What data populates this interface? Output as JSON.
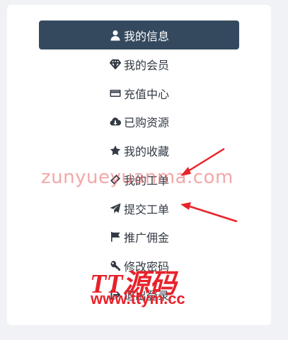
{
  "menu": {
    "items": [
      {
        "label": "我的信息",
        "icon": "user-icon",
        "active": true
      },
      {
        "label": "我的会员",
        "icon": "diamond-icon"
      },
      {
        "label": "充值中心",
        "icon": "credit-card-icon"
      },
      {
        "label": "已购资源",
        "icon": "cloud-download-icon"
      },
      {
        "label": "我的收藏",
        "icon": "star-icon"
      },
      {
        "label": "我的工单",
        "icon": "ticket-icon"
      },
      {
        "label": "提交工单",
        "icon": "paper-plane-icon"
      },
      {
        "label": "推广佣金",
        "icon": "flag-icon"
      },
      {
        "label": "修改密码",
        "icon": "key-icon"
      },
      {
        "label": "退出登录",
        "icon": "sign-out-icon"
      }
    ]
  },
  "overlays": {
    "watermark_text": "zunyueyuanma.com",
    "logo_text": "TT源码",
    "logo_url": "www.ttym.cc"
  },
  "colors": {
    "active_bg": "#34495e",
    "active_text": "#ffffff",
    "item_text": "#333a44",
    "arrow": "#e8222a",
    "watermark": "#eb5f5f",
    "stamp": "#e8222a",
    "page_bg": "#f0f2f5",
    "card_bg": "#ffffff"
  }
}
